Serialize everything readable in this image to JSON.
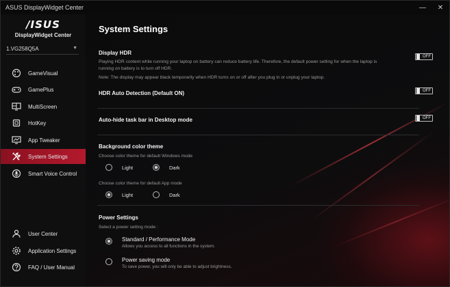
{
  "window": {
    "title": "ASUS DisplayWidget Center",
    "minimize": "—",
    "close": "✕"
  },
  "sidebar": {
    "brand": "/ISUS",
    "app_name": "DisplayWidget Center",
    "monitor": "1.VG258Q5A",
    "items": [
      {
        "label": "GameVisual",
        "icon": "palette-icon"
      },
      {
        "label": "GamePlus",
        "icon": "gamepad-icon"
      },
      {
        "label": "MultiScreen",
        "icon": "multiscreen-icon"
      },
      {
        "label": "HotKey",
        "icon": "hotkey-icon"
      },
      {
        "label": "App Tweaker",
        "icon": "app-tweaker-icon"
      },
      {
        "label": "System Settings",
        "icon": "tools-icon",
        "active": true
      },
      {
        "label": "Smart Voice Control",
        "icon": "voice-icon"
      }
    ],
    "bottom_items": [
      {
        "label": "User Center",
        "icon": "user-icon"
      },
      {
        "label": "Application Settings",
        "icon": "gear-icon"
      },
      {
        "label": "FAQ / User Manual",
        "icon": "help-icon"
      }
    ]
  },
  "main": {
    "title": "System Settings",
    "display_hdr": {
      "label": "Display HDR",
      "desc1": "Playing HDR content while running your laptop on battery can reduce battery life. Therefore, the default power setting for when the laptop is",
      "desc2": "running on battery is to turn off HDR.",
      "note": "Note: The display may appear black temporarily when HDR turns on or off after you plug in or unplug your laptop.",
      "toggle": "OFF"
    },
    "hdr_auto": {
      "label": "HDR Auto Detection (Default ON)",
      "toggle": "OFF"
    },
    "auto_hide": {
      "label": "Auto-hide task bar in Desktop mode",
      "toggle": "OFF"
    },
    "bg_theme": {
      "label": "Background color theme",
      "windows_prompt": "Choose color theme for default Windows mode",
      "windows_options": [
        "Light",
        "Dark"
      ],
      "windows_selected": "Dark",
      "app_prompt": "Choose color theme for default App mode",
      "app_options": [
        "Light",
        "Dark"
      ],
      "app_selected": "Light"
    },
    "power": {
      "label": "Power Settings",
      "prompt": "Select a power setting mode :",
      "options": [
        {
          "title": "Standard / Performance Mode",
          "desc": "Allows you access to all functions in the system."
        },
        {
          "title": "Power saving mode",
          "desc": "To save power, you will only be able to adjust brightness."
        }
      ],
      "selected": "Standard / Performance Mode"
    }
  },
  "colors": {
    "accent": "#b3192c",
    "background": "#0a0a0a"
  }
}
